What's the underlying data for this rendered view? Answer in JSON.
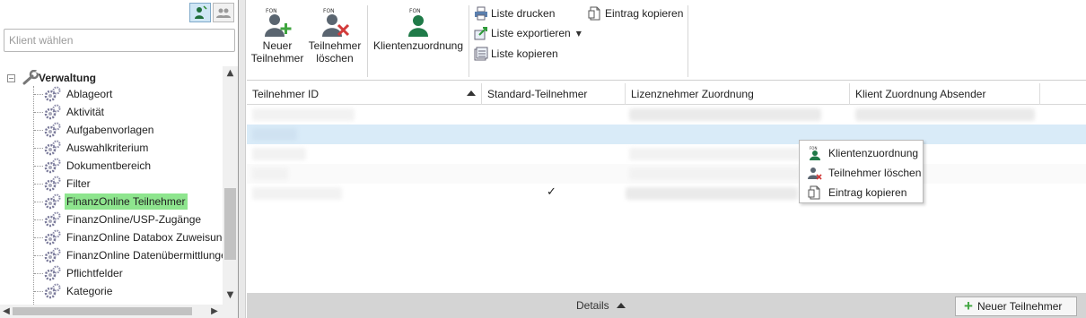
{
  "sidebar": {
    "search_placeholder": "Klient wählen",
    "root_label": "Verwaltung",
    "root_expander": "−",
    "items": [
      {
        "label": "Ablageort"
      },
      {
        "label": "Aktivität"
      },
      {
        "label": "Aufgabenvorlagen"
      },
      {
        "label": "Auswahlkriterium"
      },
      {
        "label": "Dokumentbereich"
      },
      {
        "label": "Filter"
      },
      {
        "label": "FinanzOnline Teilnehmer",
        "selected": true
      },
      {
        "label": "FinanzOnline/USP-Zugänge"
      },
      {
        "label": "FinanzOnline Databox Zuweisungen"
      },
      {
        "label": "FinanzOnline Datenübermittlungen"
      },
      {
        "label": "Pflichtfelder"
      },
      {
        "label": "Kategorie"
      }
    ],
    "highlight_color": "#8ee58e"
  },
  "ribbon": {
    "new_participant": "Neuer\nTeilnehmer",
    "delete_participant": "Teilnehmer\nlöschen",
    "client_assignment": "Klientenzuordnung",
    "print_list": "Liste drucken",
    "export_list": "Liste exportieren",
    "copy_list": "Liste kopieren",
    "copy_entry": "Eintrag kopieren"
  },
  "grid": {
    "columns": [
      "Teilnehmer ID",
      "Standard-Teilnehmer",
      "Lizenznehmer Zuordnung",
      "Klient Zuordnung Absender"
    ],
    "check_mark": "✓",
    "selected_row_color": "#d9ebf8"
  },
  "context_menu": {
    "items": [
      "Klientenzuordnung",
      "Teilnehmer löschen",
      "Eintrag kopieren"
    ]
  },
  "footer": {
    "details_label": "Details",
    "new_participant_button": "Neuer Teilnehmer"
  },
  "icons": {
    "fon_label": "FON",
    "arrow_up": "▲",
    "arrow_down": "▼",
    "arrow_left": "◀",
    "arrow_right": "▶",
    "caret": "▼"
  }
}
